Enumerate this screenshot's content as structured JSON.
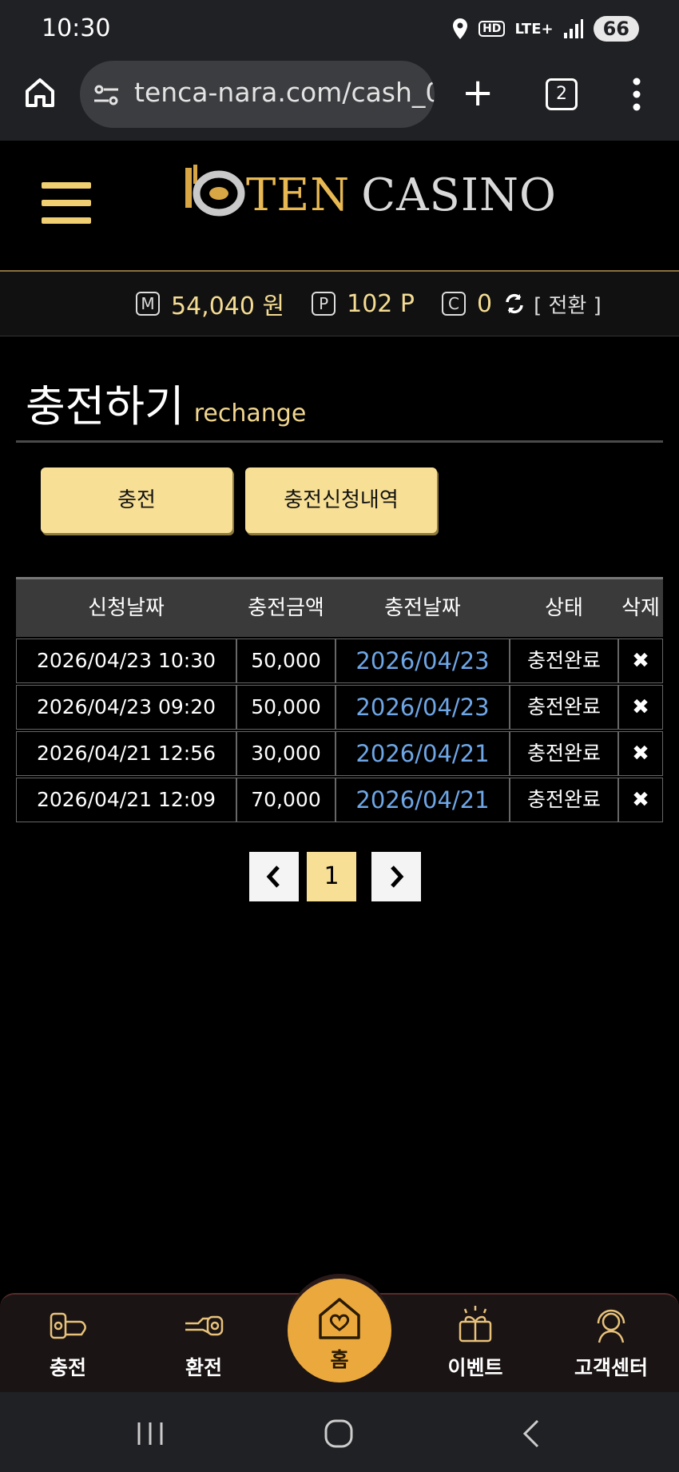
{
  "status_bar": {
    "time": "10:30",
    "network": "LTE+",
    "hd": "HD",
    "battery": "66"
  },
  "browser": {
    "url": "tenca-nara.com/cash_0",
    "tab_count": "2"
  },
  "logo": {
    "part1": "TEN",
    "part2": "CASINO"
  },
  "balance": {
    "money_icon": "M",
    "money": "54,040 원",
    "point_icon": "P",
    "point": "102 P",
    "coin_icon": "C",
    "coin": "0",
    "switch_label": "[ 전환 ]"
  },
  "page": {
    "title": "충전하기",
    "subtitle": "rechange"
  },
  "buttons": {
    "charge": "충전",
    "history": "충전신청내역"
  },
  "table": {
    "headers": [
      "신청날짜",
      "충전금액",
      "충전날짜",
      "상태",
      "삭제"
    ],
    "rows": [
      {
        "requested": "2026/04/23 10:30",
        "amount": "50,000",
        "charged": "2026/04/23",
        "status": "충전완료",
        "delete": "✖"
      },
      {
        "requested": "2026/04/23 09:20",
        "amount": "50,000",
        "charged": "2026/04/23",
        "status": "충전완료",
        "delete": "✖"
      },
      {
        "requested": "2026/04/21 12:56",
        "amount": "30,000",
        "charged": "2026/04/21",
        "status": "충전완료",
        "delete": "✖"
      },
      {
        "requested": "2026/04/21 12:09",
        "amount": "70,000",
        "charged": "2026/04/21",
        "status": "충전완료",
        "delete": "✖"
      }
    ]
  },
  "pagination": {
    "prev": "‹",
    "current": "1",
    "next": "›"
  },
  "bottom_nav": {
    "charge": "충전",
    "exchange": "환전",
    "home": "홈",
    "event": "이벤트",
    "support": "고객센터"
  },
  "colors": {
    "gold": "#f7df95",
    "accent": "#eba93d",
    "link": "#6ea6e6"
  }
}
